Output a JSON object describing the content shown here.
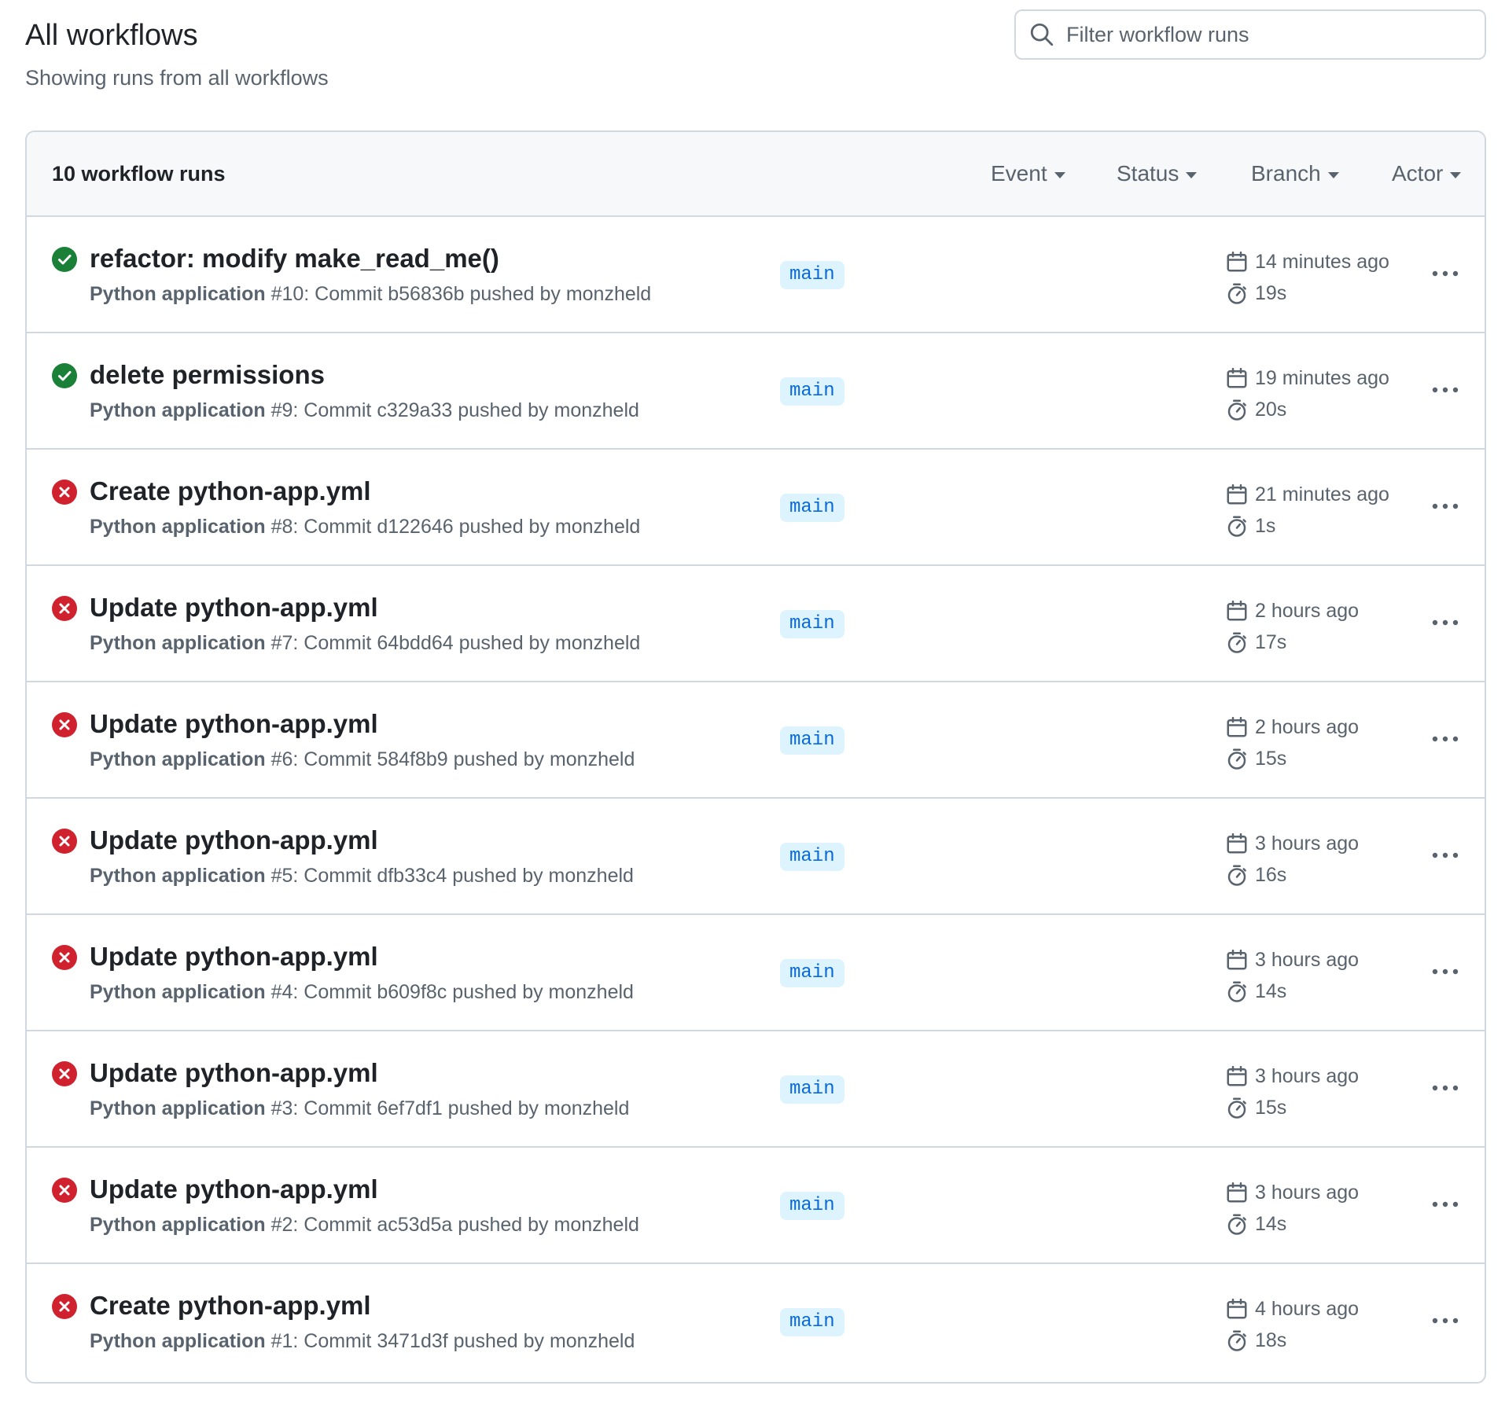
{
  "header": {
    "title": "All workflows",
    "subtitle": "Showing runs from all workflows"
  },
  "search": {
    "placeholder": "Filter workflow runs",
    "value": ""
  },
  "list": {
    "count_label": "10 workflow runs",
    "filters": [
      "Event",
      "Status",
      "Branch",
      "Actor"
    ]
  },
  "colors": {
    "success": "#1a7f37",
    "failure": "#cf222e",
    "branch_bg": "#ddf4ff",
    "branch_fg": "#0969da"
  },
  "runs": [
    {
      "status": "success",
      "title": "refactor: modify make_read_me()",
      "workflow": "Python application",
      "meta": " #10: Commit b56836b pushed by monzheld",
      "branch": "main",
      "when": "14 minutes ago",
      "duration": "19s"
    },
    {
      "status": "success",
      "title": "delete permissions",
      "workflow": "Python application",
      "meta": " #9: Commit c329a33 pushed by monzheld",
      "branch": "main",
      "when": "19 minutes ago",
      "duration": "20s"
    },
    {
      "status": "failure",
      "title": "Create python-app.yml",
      "workflow": "Python application",
      "meta": " #8: Commit d122646 pushed by monzheld",
      "branch": "main",
      "when": "21 minutes ago",
      "duration": "1s"
    },
    {
      "status": "failure",
      "title": "Update python-app.yml",
      "workflow": "Python application",
      "meta": " #7: Commit 64bdd64 pushed by monzheld",
      "branch": "main",
      "when": "2 hours ago",
      "duration": "17s"
    },
    {
      "status": "failure",
      "title": "Update python-app.yml",
      "workflow": "Python application",
      "meta": " #6: Commit 584f8b9 pushed by monzheld",
      "branch": "main",
      "when": "2 hours ago",
      "duration": "15s"
    },
    {
      "status": "failure",
      "title": "Update python-app.yml",
      "workflow": "Python application",
      "meta": " #5: Commit dfb33c4 pushed by monzheld",
      "branch": "main",
      "when": "3 hours ago",
      "duration": "16s"
    },
    {
      "status": "failure",
      "title": "Update python-app.yml",
      "workflow": "Python application",
      "meta": " #4: Commit b609f8c pushed by monzheld",
      "branch": "main",
      "when": "3 hours ago",
      "duration": "14s"
    },
    {
      "status": "failure",
      "title": "Update python-app.yml",
      "workflow": "Python application",
      "meta": " #3: Commit 6ef7df1 pushed by monzheld",
      "branch": "main",
      "when": "3 hours ago",
      "duration": "15s"
    },
    {
      "status": "failure",
      "title": "Update python-app.yml",
      "workflow": "Python application",
      "meta": " #2: Commit ac53d5a pushed by monzheld",
      "branch": "main",
      "when": "3 hours ago",
      "duration": "14s"
    },
    {
      "status": "failure",
      "title": "Create python-app.yml",
      "workflow": "Python application",
      "meta": " #1: Commit 3471d3f pushed by monzheld",
      "branch": "main",
      "when": "4 hours ago",
      "duration": "18s"
    }
  ]
}
